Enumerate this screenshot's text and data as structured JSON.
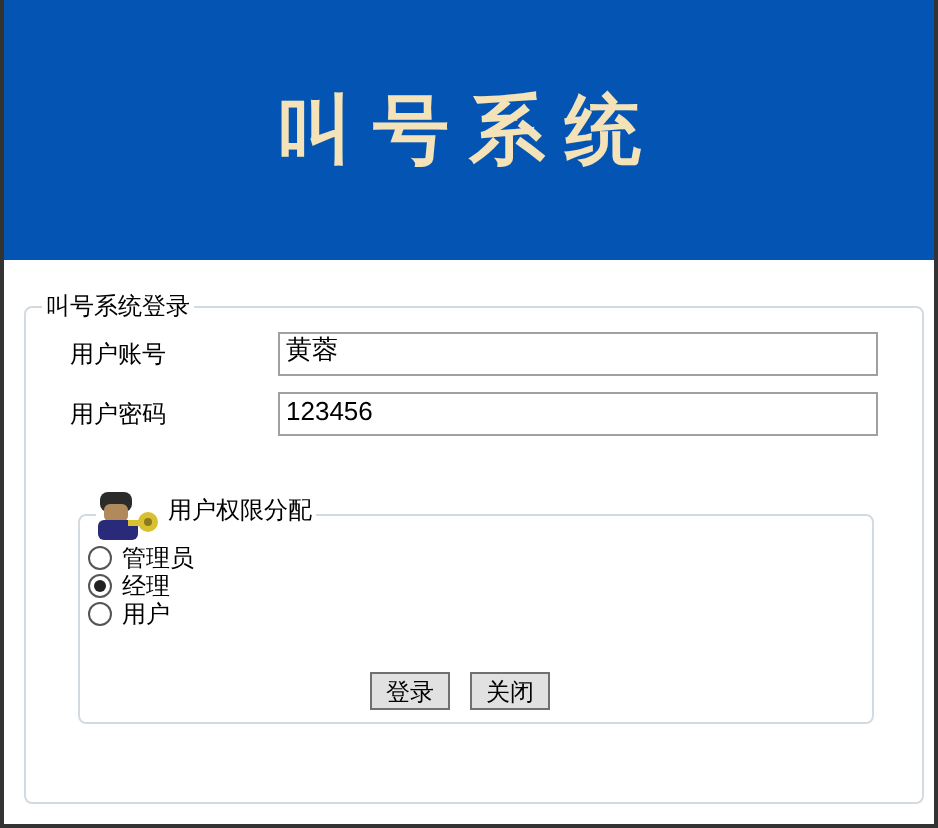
{
  "header": {
    "title": "叫号系统"
  },
  "login_group": {
    "legend": "叫号系统登录",
    "fields": [
      {
        "label": "用户账号",
        "value": "黄蓉"
      },
      {
        "label": "用户密码",
        "value": "123456"
      }
    ]
  },
  "role_group": {
    "legend": "用户权限分配",
    "options": [
      {
        "label": "管理员",
        "selected": false
      },
      {
        "label": "经理",
        "selected": true
      },
      {
        "label": "用户",
        "selected": false
      }
    ]
  },
  "buttons": [
    "登录",
    "关闭"
  ]
}
